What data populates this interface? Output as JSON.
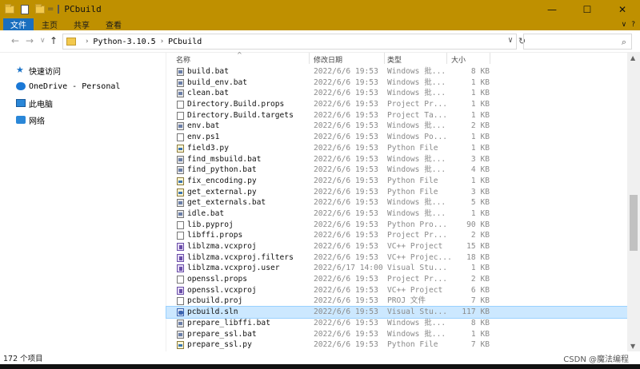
{
  "window": {
    "title": "PCbuild",
    "title_separator": "=",
    "controls": {
      "minimize": "—",
      "maximize": "☐",
      "close": "✕"
    }
  },
  "ribbon": {
    "tabs": [
      "文件",
      "主页",
      "共享",
      "查看"
    ],
    "collapse_glyph": "∨",
    "help_glyph": "?"
  },
  "address": {
    "crumbs": [
      "Python-3.10.5",
      "PCbuild"
    ],
    "dropdown_glyph": "∨",
    "refresh_glyph": "↻",
    "search_placeholder": "",
    "nav": {
      "back": "←",
      "forward": "→",
      "recent": "∨",
      "up": "↑"
    }
  },
  "navpane": {
    "items": [
      {
        "label": "快速访问",
        "icon": "star-icon"
      },
      {
        "label": "OneDrive - Personal",
        "icon": "cloud-icon"
      },
      {
        "label": "此电脑",
        "icon": "computer-icon"
      },
      {
        "label": "网络",
        "icon": "network-icon"
      }
    ]
  },
  "columns": {
    "name": "名称",
    "date": "修改日期",
    "type": "类型",
    "size": "大小",
    "sort_glyph": "^"
  },
  "files": [
    {
      "name": "build.bat",
      "date": "2022/6/6 19:53",
      "type": "Windows 批...",
      "size": "8 KB",
      "icon": "bat"
    },
    {
      "name": "build_env.bat",
      "date": "2022/6/6 19:53",
      "type": "Windows 批...",
      "size": "1 KB",
      "icon": "bat"
    },
    {
      "name": "clean.bat",
      "date": "2022/6/6 19:53",
      "type": "Windows 批...",
      "size": "1 KB",
      "icon": "bat"
    },
    {
      "name": "Directory.Build.props",
      "date": "2022/6/6 19:53",
      "type": "Project Pr...",
      "size": "1 KB",
      "icon": "doc"
    },
    {
      "name": "Directory.Build.targets",
      "date": "2022/6/6 19:53",
      "type": "Project Ta...",
      "size": "1 KB",
      "icon": "doc"
    },
    {
      "name": "env.bat",
      "date": "2022/6/6 19:53",
      "type": "Windows 批...",
      "size": "2 KB",
      "icon": "bat"
    },
    {
      "name": "env.ps1",
      "date": "2022/6/6 19:53",
      "type": "Windows Po...",
      "size": "1 KB",
      "icon": "doc"
    },
    {
      "name": "field3.py",
      "date": "2022/6/6 19:53",
      "type": "Python File",
      "size": "1 KB",
      "icon": "py"
    },
    {
      "name": "find_msbuild.bat",
      "date": "2022/6/6 19:53",
      "type": "Windows 批...",
      "size": "3 KB",
      "icon": "bat"
    },
    {
      "name": "find_python.bat",
      "date": "2022/6/6 19:53",
      "type": "Windows 批...",
      "size": "4 KB",
      "icon": "bat"
    },
    {
      "name": "fix_encoding.py",
      "date": "2022/6/6 19:53",
      "type": "Python File",
      "size": "1 KB",
      "icon": "py"
    },
    {
      "name": "get_external.py",
      "date": "2022/6/6 19:53",
      "type": "Python File",
      "size": "3 KB",
      "icon": "py"
    },
    {
      "name": "get_externals.bat",
      "date": "2022/6/6 19:53",
      "type": "Windows 批...",
      "size": "5 KB",
      "icon": "bat"
    },
    {
      "name": "idle.bat",
      "date": "2022/6/6 19:53",
      "type": "Windows 批...",
      "size": "1 KB",
      "icon": "bat"
    },
    {
      "name": "lib.pyproj",
      "date": "2022/6/6 19:53",
      "type": "Python Pro...",
      "size": "90 KB",
      "icon": "doc"
    },
    {
      "name": "libffi.props",
      "date": "2022/6/6 19:53",
      "type": "Project Pr...",
      "size": "2 KB",
      "icon": "doc"
    },
    {
      "name": "liblzma.vcxproj",
      "date": "2022/6/6 19:53",
      "type": "VC++ Project",
      "size": "15 KB",
      "icon": "vc"
    },
    {
      "name": "liblzma.vcxproj.filters",
      "date": "2022/6/6 19:53",
      "type": "VC++ Projec...",
      "size": "18 KB",
      "icon": "vc"
    },
    {
      "name": "liblzma.vcxproj.user",
      "date": "2022/6/17 14:00",
      "type": "Visual Stu...",
      "size": "1 KB",
      "icon": "vc"
    },
    {
      "name": "openssl.props",
      "date": "2022/6/6 19:53",
      "type": "Project Pr...",
      "size": "2 KB",
      "icon": "doc"
    },
    {
      "name": "openssl.vcxproj",
      "date": "2022/6/6 19:53",
      "type": "VC++ Project",
      "size": "6 KB",
      "icon": "vc"
    },
    {
      "name": "pcbuild.proj",
      "date": "2022/6/6 19:53",
      "type": "PROJ 文件",
      "size": "7 KB",
      "icon": "doc"
    },
    {
      "name": "pcbuild.sln",
      "date": "2022/6/6 19:53",
      "type": "Visual Stu...",
      "size": "117 KB",
      "icon": "sln",
      "selected": true
    },
    {
      "name": "prepare_libffi.bat",
      "date": "2022/6/6 19:53",
      "type": "Windows 批...",
      "size": "8 KB",
      "icon": "bat"
    },
    {
      "name": "prepare_ssl.bat",
      "date": "2022/6/6 19:53",
      "type": "Windows 批...",
      "size": "1 KB",
      "icon": "bat"
    },
    {
      "name": "prepare_ssl.py",
      "date": "2022/6/6 19:53",
      "type": "Python File",
      "size": "7 KB",
      "icon": "py"
    }
  ],
  "status": {
    "count": "172 个项目"
  },
  "watermark": "CSDN @魔法编程"
}
